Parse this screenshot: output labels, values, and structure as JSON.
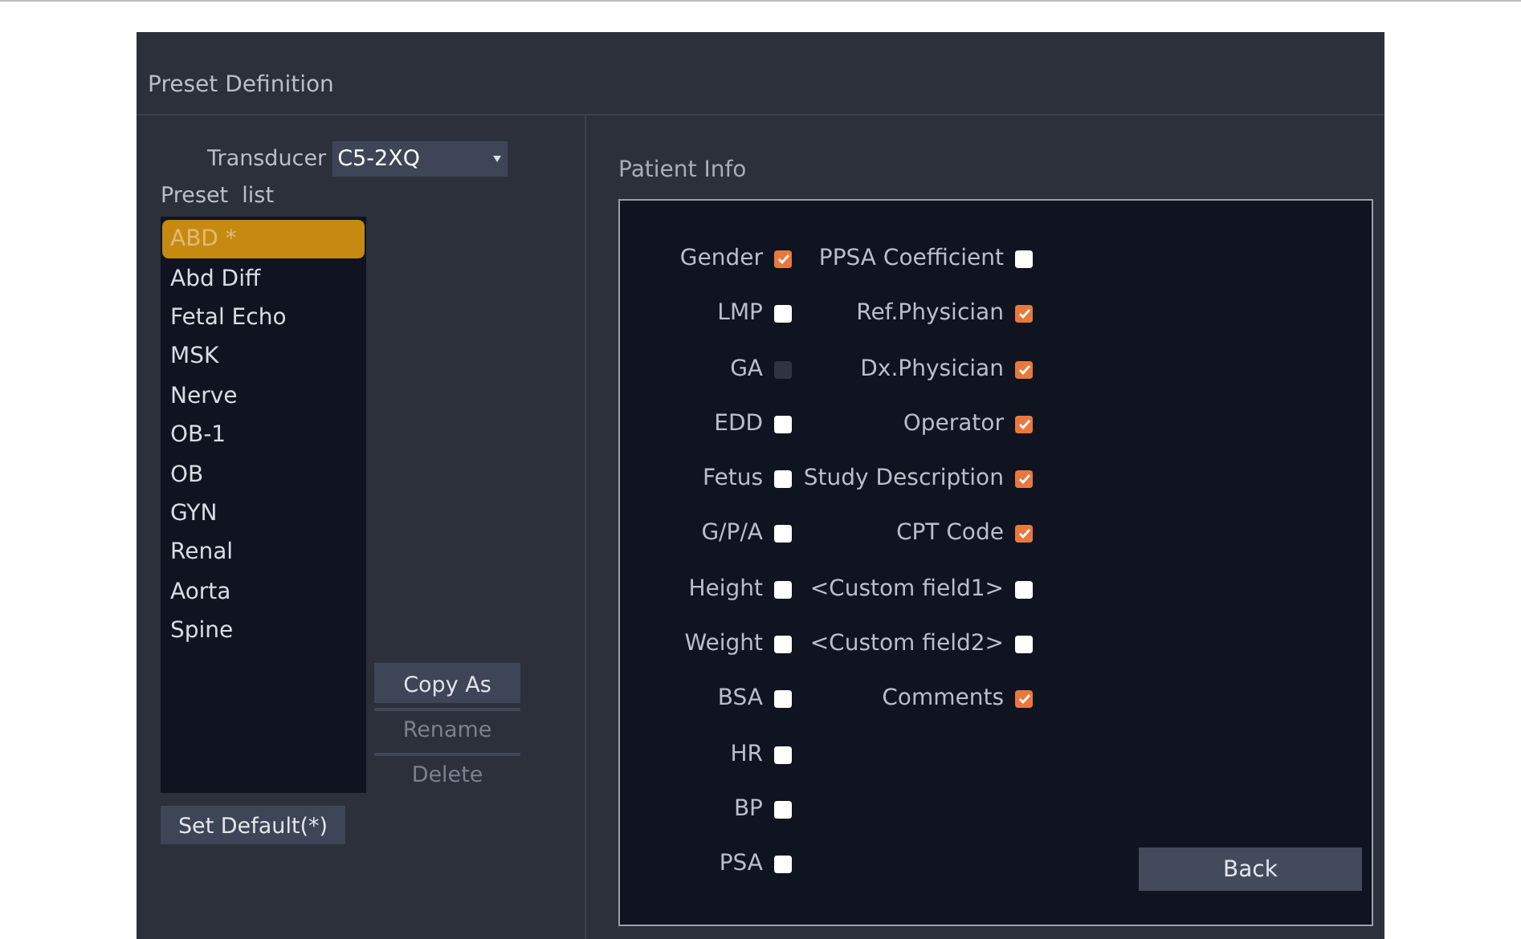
{
  "window": {
    "title": "Preset Definition"
  },
  "transducer": {
    "label": "Transducer",
    "value": "C5-2XQ"
  },
  "preset_list": {
    "label": "Preset  list",
    "items": [
      {
        "label": "ABD *",
        "selected": true
      },
      {
        "label": "Abd Diff",
        "selected": false
      },
      {
        "label": "Fetal Echo",
        "selected": false
      },
      {
        "label": "MSK",
        "selected": false
      },
      {
        "label": "Nerve",
        "selected": false
      },
      {
        "label": "OB-1",
        "selected": false
      },
      {
        "label": "OB",
        "selected": false
      },
      {
        "label": "GYN",
        "selected": false
      },
      {
        "label": "Renal",
        "selected": false
      },
      {
        "label": "Aorta",
        "selected": false
      },
      {
        "label": "Spine",
        "selected": false
      }
    ]
  },
  "list_buttons": [
    {
      "label": "Copy As",
      "disabled": false
    },
    {
      "label": "Rename",
      "disabled": true
    },
    {
      "label": "Delete",
      "disabled": true
    }
  ],
  "set_default_button": "Set Default(*)",
  "patient_info": {
    "title": "Patient Info",
    "column_1": [
      {
        "label": "Gender",
        "checked": true,
        "disabled": false
      },
      {
        "label": "LMP",
        "checked": false,
        "disabled": false
      },
      {
        "label": "GA",
        "checked": false,
        "disabled": true
      },
      {
        "label": "EDD",
        "checked": false,
        "disabled": false
      },
      {
        "label": "Fetus",
        "checked": false,
        "disabled": false
      },
      {
        "label": "G/P/A",
        "checked": false,
        "disabled": false
      },
      {
        "label": "Height",
        "checked": false,
        "disabled": false
      },
      {
        "label": "Weight",
        "checked": false,
        "disabled": false
      },
      {
        "label": "BSA",
        "checked": false,
        "disabled": false
      },
      {
        "label": "HR",
        "checked": false,
        "disabled": false
      },
      {
        "label": "BP",
        "checked": false,
        "disabled": false
      },
      {
        "label": "PSA",
        "checked": false,
        "disabled": false
      }
    ],
    "column_2": [
      {
        "label": "PPSA Coefficient",
        "checked": false,
        "disabled": false
      },
      {
        "label": "Ref.Physician",
        "checked": true,
        "disabled": false
      },
      {
        "label": "Dx.Physician",
        "checked": true,
        "disabled": false
      },
      {
        "label": "Operator",
        "checked": true,
        "disabled": false
      },
      {
        "label": "Study Description",
        "checked": true,
        "disabled": false
      },
      {
        "label": "CPT Code",
        "checked": true,
        "disabled": false
      },
      {
        "label": "<Custom field1>",
        "checked": false,
        "disabled": false
      },
      {
        "label": "<Custom field2>",
        "checked": false,
        "disabled": false
      },
      {
        "label": "Comments",
        "checked": true,
        "disabled": false
      }
    ],
    "back_button": "Back"
  }
}
